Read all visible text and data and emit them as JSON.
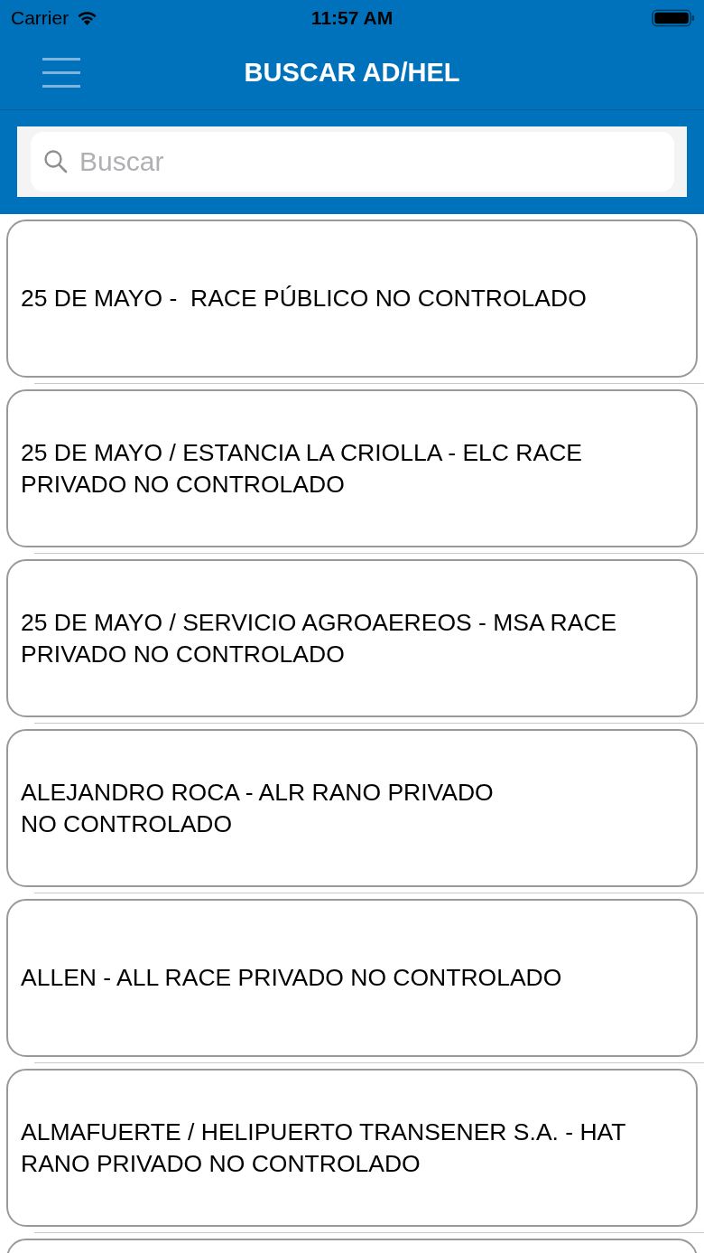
{
  "status_bar": {
    "carrier": "Carrier",
    "time": "11:57 AM"
  },
  "nav": {
    "title": "BUSCAR AD/HEL"
  },
  "search": {
    "placeholder": "Buscar"
  },
  "results": [
    {
      "label": "25 DE MAYO -  RACE PÚBLICO NO CONTROLADO"
    },
    {
      "label": "25 DE MAYO / ESTANCIA LA CRIOLLA - ELC RACE PRIVADO NO CONTROLADO"
    },
    {
      "label": "25 DE MAYO / SERVICIO AGROAEREOS - MSA RACE PRIVADO NO CONTROLADO"
    },
    {
      "label": "ALEJANDRO ROCA - ALR RANO PRIVADO\nNO CONTROLADO"
    },
    {
      "label": "ALLEN - ALL RACE PRIVADO NO CONTROLADO"
    },
    {
      "label": "ALMAFUERTE / HELIPUERTO TRANSENER S.A. - HAT RANO PRIVADO NO CONTROLADO"
    }
  ]
}
